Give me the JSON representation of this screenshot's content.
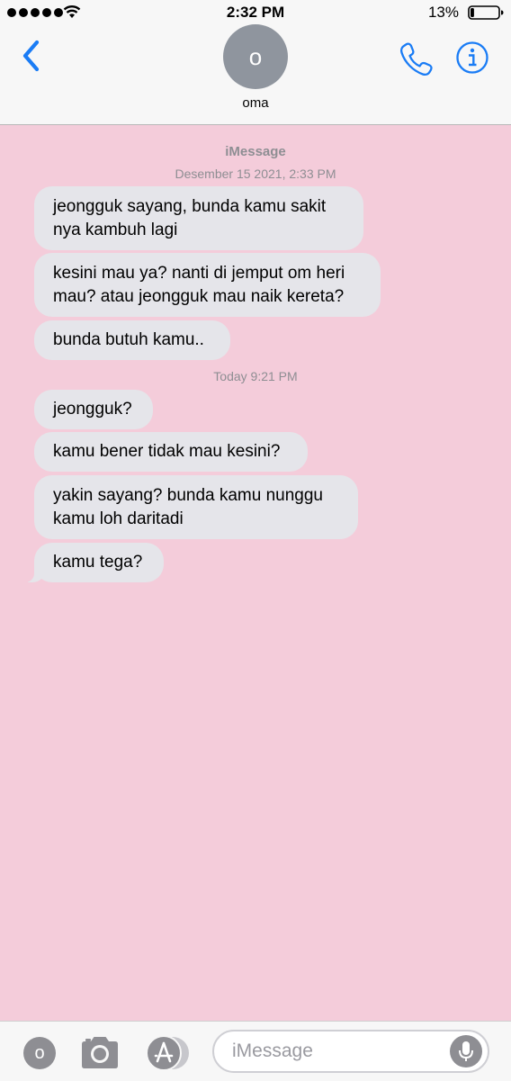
{
  "status_bar": {
    "time": "2:32 PM",
    "battery_percent": "13%",
    "battery_level": 0.13,
    "signal_bars": 5
  },
  "header": {
    "contact_initial": "o",
    "contact_name": "oma",
    "accent_color": "#1a7cf5"
  },
  "conversation": {
    "service_label": "iMessage",
    "background_color": "#f4ccda",
    "timestamps": [
      "Desember 15 2021, 2:33 PM",
      "Today 9:21 PM"
    ],
    "messages": [
      {
        "text": "jeongguk sayang, bunda kamu sakit nya kambuh lagi"
      },
      {
        "text": "kesini mau ya? nanti di jemput om heri mau? atau jeongguk mau naik kereta?"
      },
      {
        "text": "bunda butuh kamu.."
      },
      {
        "text": "jeongguk?"
      },
      {
        "text": "kamu bener tidak mau kesini?"
      },
      {
        "text": "yakin sayang? bunda kamu nunggu kamu loh daritadi"
      },
      {
        "text": "kamu tega?"
      }
    ]
  },
  "input_bar": {
    "digital_touch_initial": "o",
    "placeholder": "iMessage"
  }
}
